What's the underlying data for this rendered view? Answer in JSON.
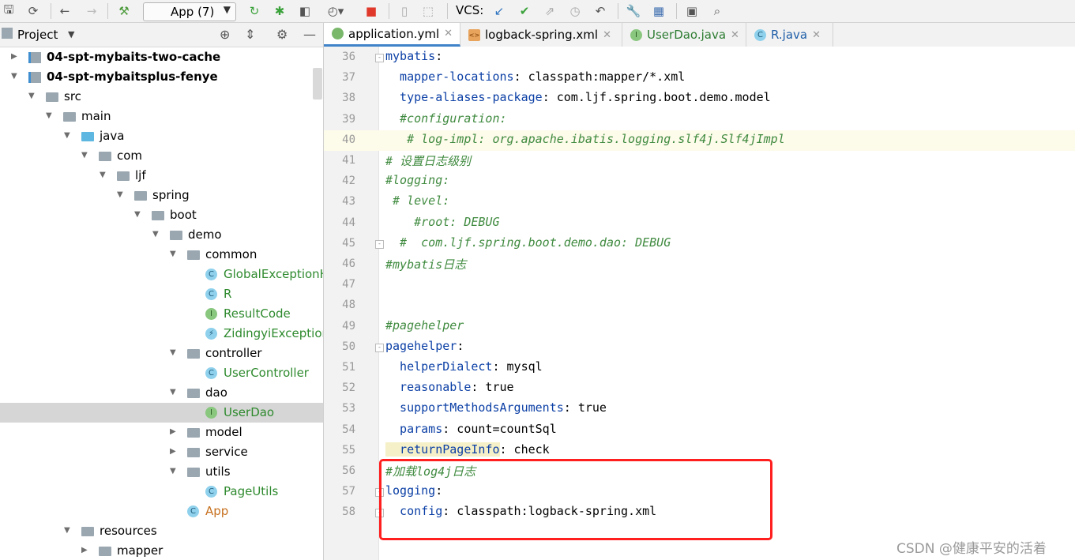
{
  "toolbar": {
    "run_config": "App (7)",
    "vcs_label": "VCS:"
  },
  "project_panel": {
    "title": "Project"
  },
  "tree": [
    {
      "label": "04-spt-mybaits-two-cache",
      "bold": true,
      "icon": "module-icon"
    },
    {
      "label": "04-spt-mybaitsplus-fenye",
      "bold": true,
      "icon": "module-icon"
    },
    {
      "label": "src",
      "icon": "folder-icon"
    },
    {
      "label": "main",
      "icon": "folder-icon"
    },
    {
      "label": "java",
      "icon": "source-folder-icon"
    },
    {
      "label": "com",
      "icon": "package-icon"
    },
    {
      "label": "ljf",
      "icon": "package-icon"
    },
    {
      "label": "spring",
      "icon": "package-icon"
    },
    {
      "label": "boot",
      "icon": "package-icon"
    },
    {
      "label": "demo",
      "icon": "package-icon"
    },
    {
      "label": "common",
      "icon": "package-icon"
    },
    {
      "label": "GlobalExceptionH",
      "icon": "class-icon",
      "badge": "C"
    },
    {
      "label": "R",
      "icon": "class-icon",
      "badge": "C"
    },
    {
      "label": "ResultCode",
      "icon": "interface-icon",
      "badge": "I"
    },
    {
      "label": "ZidingyiException",
      "icon": "exception-icon",
      "badge": "⚡"
    },
    {
      "label": "controller",
      "icon": "package-icon"
    },
    {
      "label": "UserController",
      "icon": "class-icon",
      "badge": "C"
    },
    {
      "label": "dao",
      "icon": "package-icon"
    },
    {
      "label": "UserDao",
      "icon": "interface-icon",
      "badge": "I"
    },
    {
      "label": "model",
      "icon": "package-icon"
    },
    {
      "label": "service",
      "icon": "package-icon"
    },
    {
      "label": "utils",
      "icon": "package-icon"
    },
    {
      "label": "PageUtils",
      "icon": "class-icon",
      "badge": "C"
    },
    {
      "label": "App",
      "icon": "spring-app-icon",
      "badge": "C"
    },
    {
      "label": "resources",
      "icon": "resources-folder-icon"
    },
    {
      "label": "mapper",
      "icon": "folder-icon"
    }
  ],
  "tabs": [
    {
      "label": "application.yml",
      "icon": "yaml-icon",
      "active": true
    },
    {
      "label": "logback-spring.xml",
      "icon": "xml-icon",
      "active": false
    },
    {
      "label": "UserDao.java",
      "icon": "interface-icon",
      "badge": "I",
      "active": false
    },
    {
      "label": "R.java",
      "icon": "class-icon",
      "badge": "C",
      "active": false
    }
  ],
  "editor": {
    "lines": [
      {
        "n": "36",
        "parts": [
          {
            "t": "mybatis",
            "c": "k"
          },
          {
            "t": ":",
            "c": "v"
          }
        ]
      },
      {
        "n": "37",
        "parts": [
          {
            "t": "  mapper-locations",
            "c": "k"
          },
          {
            "t": ": classpath:mapper/*.xml",
            "c": "v"
          }
        ]
      },
      {
        "n": "38",
        "parts": [
          {
            "t": "  type-aliases-package",
            "c": "k"
          },
          {
            "t": ": com.ljf.spring.boot.demo.model",
            "c": "v"
          }
        ]
      },
      {
        "n": "39",
        "parts": [
          {
            "t": "  #configuration:",
            "c": "cm"
          }
        ]
      },
      {
        "n": "40",
        "parts": [
          {
            "t": "   # log-impl: org.apache.ibatis.logging.slf4j.Slf4jImpl",
            "c": "cm"
          }
        ]
      },
      {
        "n": "41",
        "parts": [
          {
            "t": "# 设置日志级别",
            "c": "cm"
          }
        ]
      },
      {
        "n": "42",
        "parts": [
          {
            "t": "#logging:",
            "c": "cm"
          }
        ]
      },
      {
        "n": "43",
        "parts": [
          {
            "t": " # level:",
            "c": "cm"
          }
        ]
      },
      {
        "n": "44",
        "parts": [
          {
            "t": "    #root: DEBUG",
            "c": "cm"
          }
        ]
      },
      {
        "n": "45",
        "parts": [
          {
            "t": "  #  com.ljf.spring.boot.demo.dao: DEBUG",
            "c": "cm"
          }
        ]
      },
      {
        "n": "46",
        "parts": [
          {
            "t": "#mybatis日志",
            "c": "cm"
          }
        ]
      },
      {
        "n": "47",
        "parts": []
      },
      {
        "n": "48",
        "parts": []
      },
      {
        "n": "49",
        "parts": [
          {
            "t": "#pagehelper",
            "c": "cm"
          }
        ]
      },
      {
        "n": "50",
        "parts": [
          {
            "t": "pagehelper",
            "c": "k"
          },
          {
            "t": ":",
            "c": "v"
          }
        ]
      },
      {
        "n": "51",
        "parts": [
          {
            "t": "  helperDialect",
            "c": "k"
          },
          {
            "t": ": mysql",
            "c": "v"
          }
        ]
      },
      {
        "n": "52",
        "parts": [
          {
            "t": "  reasonable",
            "c": "k"
          },
          {
            "t": ": true",
            "c": "v"
          }
        ]
      },
      {
        "n": "53",
        "parts": [
          {
            "t": "  supportMethodsArguments",
            "c": "k"
          },
          {
            "t": ": true",
            "c": "v"
          }
        ]
      },
      {
        "n": "54",
        "parts": [
          {
            "t": "  params",
            "c": "k"
          },
          {
            "t": ": count=countSql",
            "c": "v"
          }
        ]
      },
      {
        "n": "55",
        "parts": [
          {
            "t": "  returnPageInfo",
            "c": "k hlbox"
          },
          {
            "t": ": check",
            "c": "v"
          }
        ]
      },
      {
        "n": "56",
        "parts": [
          {
            "t": "#加载log4j日志",
            "c": "cm"
          }
        ]
      },
      {
        "n": "57",
        "parts": [
          {
            "t": "logging",
            "c": "k"
          },
          {
            "t": ":",
            "c": "v"
          }
        ]
      },
      {
        "n": "58",
        "parts": [
          {
            "t": "  config",
            "c": "k"
          },
          {
            "t": ": classpath:logback-spring.xml",
            "c": "v"
          }
        ]
      }
    ]
  },
  "watermark": "CSDN @健康平安的活着"
}
